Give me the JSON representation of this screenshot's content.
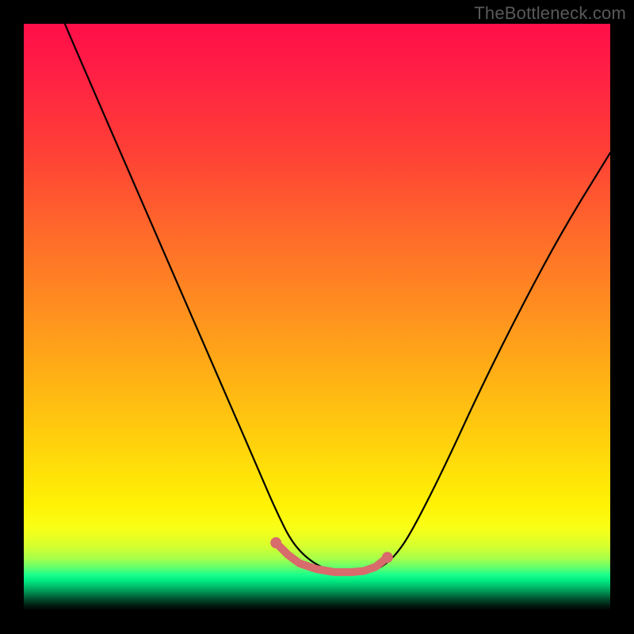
{
  "watermark": "TheBottleneck.com",
  "chart_data": {
    "type": "line",
    "title": "",
    "xlabel": "",
    "ylabel": "",
    "xlim": [
      0,
      100
    ],
    "ylim": [
      0,
      100
    ],
    "grid": false,
    "legend": false,
    "series": [
      {
        "name": "curve",
        "color": "#000000",
        "x": [
          7,
          10,
          15,
          20,
          25,
          30,
          35,
          40,
          43,
          46,
          50,
          54,
          58,
          61,
          64,
          67,
          72,
          78,
          85,
          92,
          100
        ],
        "values": [
          100,
          93,
          81.5,
          70,
          58.5,
          47,
          35.5,
          24,
          17,
          11,
          7.5,
          6.4,
          6.4,
          7.2,
          10,
          15,
          25,
          38,
          52,
          65,
          78
        ]
      },
      {
        "name": "highlight-dots",
        "color": "#d86b6b",
        "x": [
          43,
          45,
          47,
          50,
          53,
          56,
          58,
          60,
          62
        ],
        "values": [
          11.5,
          9.5,
          8.0,
          7.0,
          6.5,
          6.5,
          6.7,
          7.4,
          9.0
        ]
      }
    ],
    "annotations": []
  }
}
